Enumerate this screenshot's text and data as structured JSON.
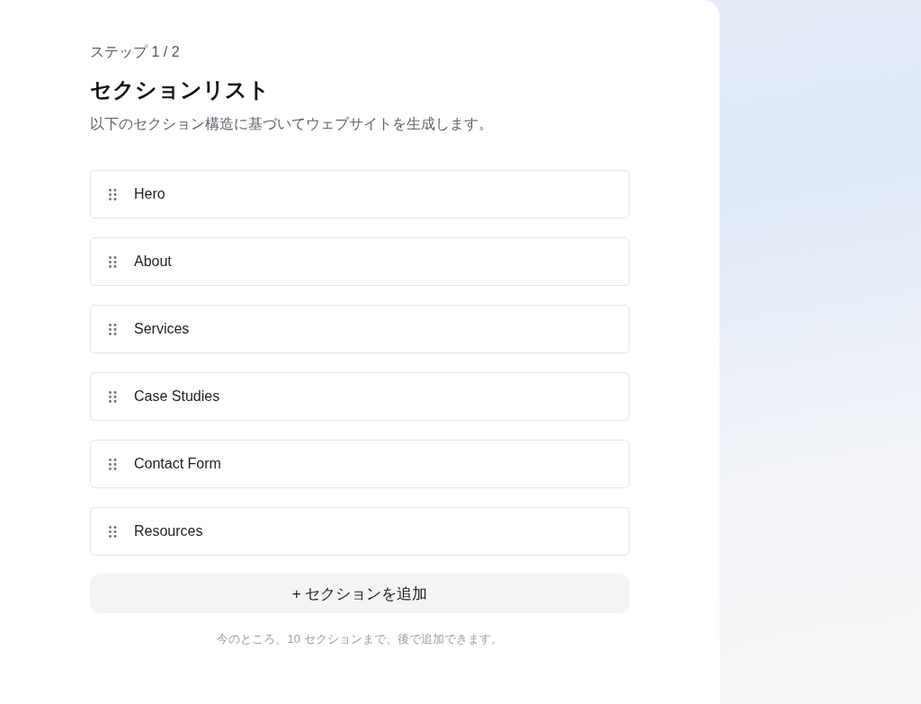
{
  "step": "ステップ 1 / 2",
  "title": "セクションリスト",
  "subtitle": "以下のセクション構造に基づいてウェブサイトを生成します。",
  "sections": [
    {
      "name": "Hero"
    },
    {
      "name": "About"
    },
    {
      "name": "Services"
    },
    {
      "name": "Case Studies"
    },
    {
      "name": "Contact Form"
    },
    {
      "name": "Resources"
    }
  ],
  "add_button": "+ セクションを追加",
  "note": "今のところ、10 セクションまで、後で追加できます。"
}
